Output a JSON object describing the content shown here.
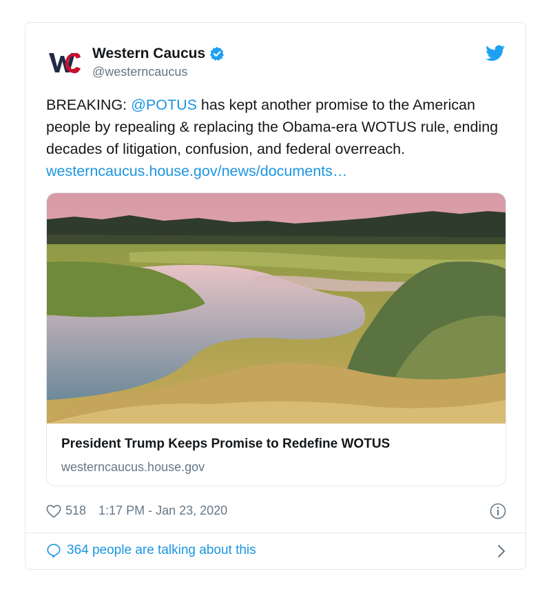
{
  "author": {
    "name": "Western Caucus",
    "handle": "@westerncaucus",
    "logo_text": "WC"
  },
  "tweet": {
    "text_before": "BREAKING: ",
    "mention": "@POTUS",
    "text_after": " has kept another promise to the American people by repealing & replacing the Obama-era WOTUS rule, ending decades of litigation, confusion, and federal overreach. ",
    "link": "westerncaucus.house.gov/news/documents…"
  },
  "card": {
    "image_icon": "wetland-landscape-photo",
    "title": "President Trump Keeps Promise to Redefine WOTUS",
    "domain": "westerncaucus.house.gov"
  },
  "meta": {
    "like_count": "518",
    "timestamp": "1:17 PM - Jan 23, 2020"
  },
  "conversation": {
    "label": "364 people are talking about this"
  },
  "colors": {
    "link": "#1b95e0",
    "muted": "#657786",
    "border": "#e1e8ed",
    "logo_red": "#c8102e",
    "logo_navy": "#1f2a44"
  }
}
